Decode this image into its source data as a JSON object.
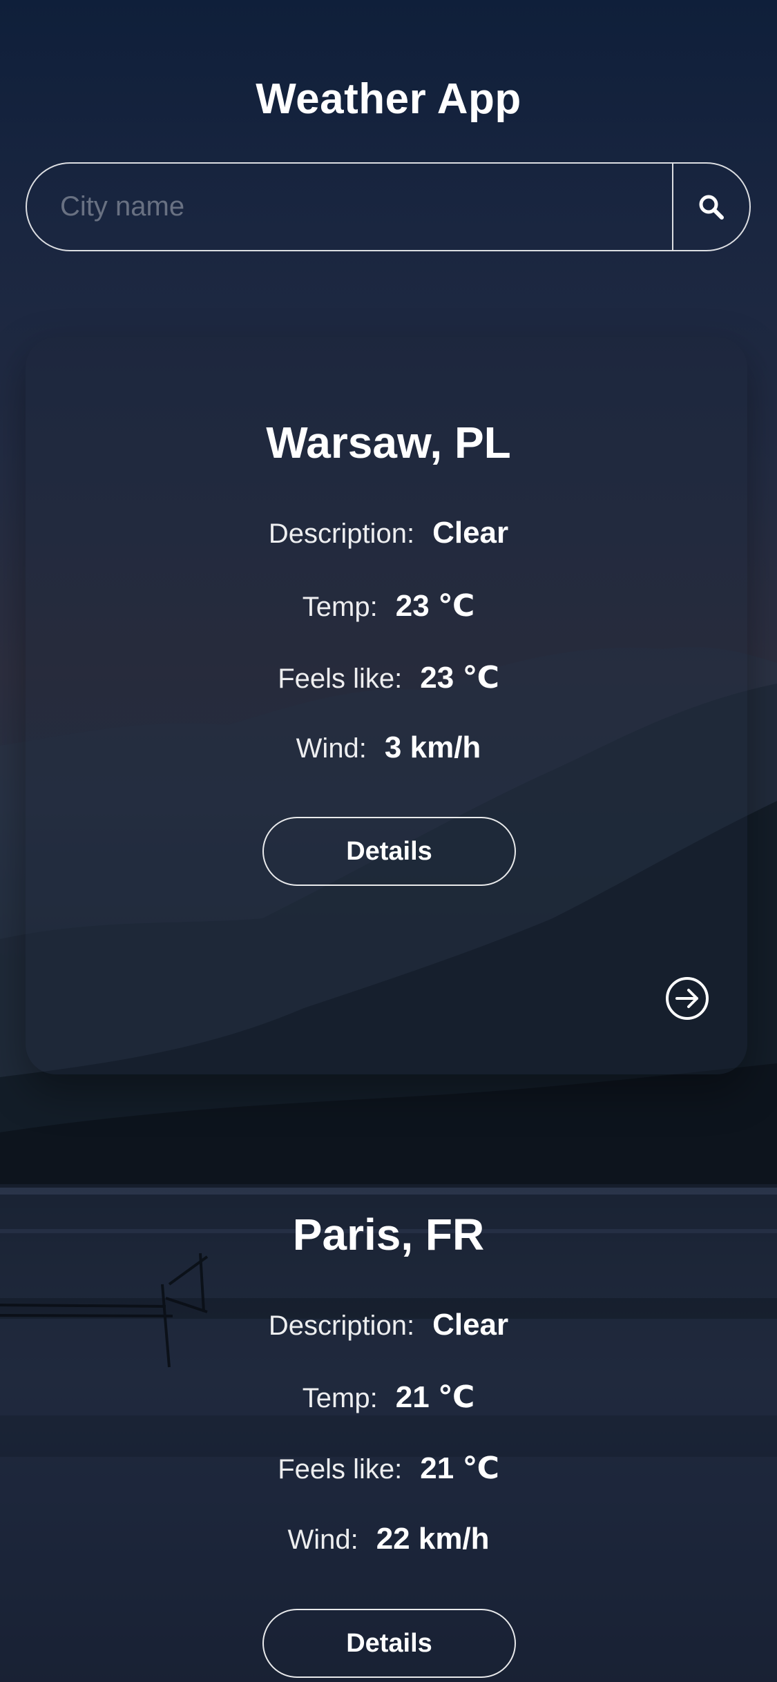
{
  "header": {
    "title": "Weather App"
  },
  "search": {
    "placeholder": "City name",
    "value": "",
    "icon": "search-icon"
  },
  "cities": [
    {
      "name": "Warsaw, PL",
      "description_label": "Description:",
      "description": "Clear",
      "temp_label": "Temp:",
      "temp": "23 ℃",
      "feels_like_label": "Feels like:",
      "feels_like": "23 ℃",
      "wind_label": "Wind:",
      "wind": "3 km/h",
      "details_label": "Details",
      "next_icon": "arrow-right-circle-icon"
    },
    {
      "name": "Paris, FR",
      "description_label": "Description:",
      "description": "Clear",
      "temp_label": "Temp:",
      "temp": "21 ℃",
      "feels_like_label": "Feels like:",
      "feels_like": "21 ℃",
      "wind_label": "Wind:",
      "wind": "22 km/h",
      "details_label": "Details"
    }
  ],
  "colors": {
    "text": "#ffffff",
    "background_top": "#0f1f3a",
    "background_bottom": "#141d30"
  }
}
